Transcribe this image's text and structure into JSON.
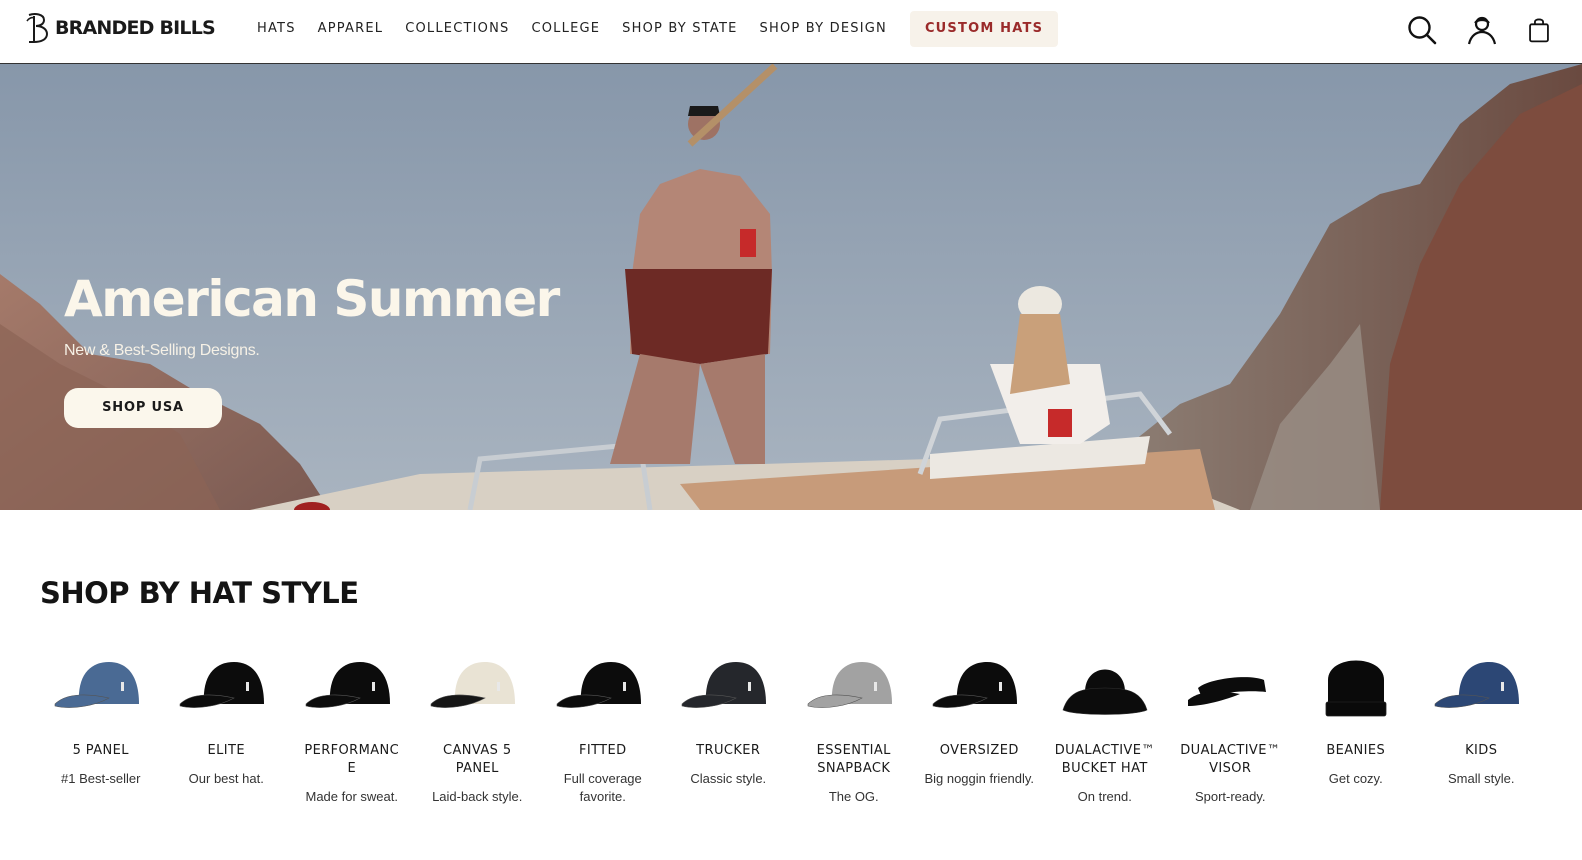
{
  "brand": {
    "name": "BRANDED BILLS"
  },
  "nav": {
    "items": [
      {
        "label": "HATS"
      },
      {
        "label": "APPAREL"
      },
      {
        "label": "COLLECTIONS"
      },
      {
        "label": "COLLEGE"
      },
      {
        "label": "SHOP BY STATE"
      },
      {
        "label": "SHOP BY DESIGN"
      }
    ],
    "custom_label": "CUSTOM HATS"
  },
  "header_icons": [
    "search-icon",
    "account-icon",
    "cart-bag-icon"
  ],
  "hero": {
    "title": "American Summer",
    "subtitle": "New & Best-Selling Designs.",
    "button_label": "SHOP USA"
  },
  "hat_styles": {
    "title": "SHOP BY HAT STYLE",
    "items": [
      {
        "name": "5 PANEL",
        "desc": "#1 Best-seller",
        "color": "#4a6a94"
      },
      {
        "name": "ELITE",
        "desc": "Our best hat.",
        "color": "#0c0c0c"
      },
      {
        "name": "PERFORMANC\nE",
        "desc": "Made for sweat.",
        "color": "#0c0c0c"
      },
      {
        "name": "CANVAS 5\nPANEL",
        "desc": "Laid-back style.",
        "color": "#e9e3d4"
      },
      {
        "name": "FITTED",
        "desc": "Full coverage favorite.",
        "color": "#0c0c0c"
      },
      {
        "name": "TRUCKER",
        "desc": "Classic style.",
        "color": "#25272c"
      },
      {
        "name": "ESSENTIAL\nSNAPBACK",
        "desc": "The OG.",
        "color": "#a2a2a2"
      },
      {
        "name": "OVERSIZED",
        "desc": "Big noggin friendly.",
        "color": "#0c0c0c"
      },
      {
        "name": "DUALACTIVE™\nBUCKET HAT",
        "desc": "On trend.",
        "color": "#0c0c0c"
      },
      {
        "name": "DUALACTIVE™\nVISOR",
        "desc": "Sport-ready.",
        "color": "#0c0c0c"
      },
      {
        "name": "BEANIES",
        "desc": "Get cozy.",
        "color": "#0a0a0a"
      },
      {
        "name": "KIDS",
        "desc": "Small style.",
        "color": "#2c4775"
      }
    ]
  }
}
